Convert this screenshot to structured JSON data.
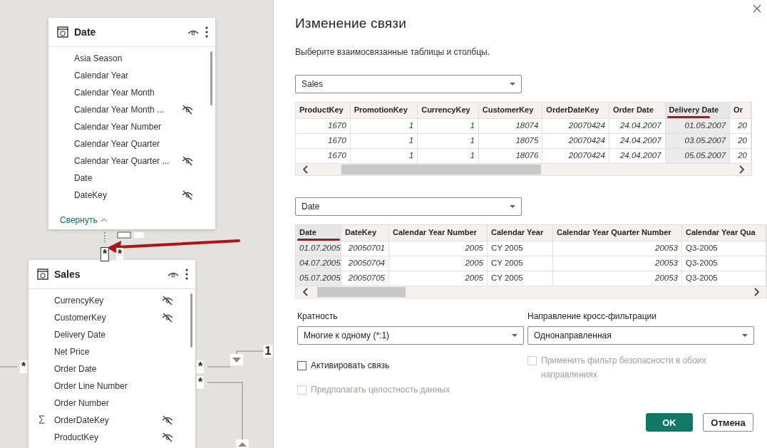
{
  "diagram": {
    "tables": [
      {
        "name": "Date",
        "collapse_link": "Свернуть",
        "fields": [
          {
            "name": "Asia Season",
            "hidden": false,
            "summarized": false
          },
          {
            "name": "Calendar Year",
            "hidden": false,
            "summarized": false
          },
          {
            "name": "Calendar Year Month",
            "hidden": false,
            "summarized": false
          },
          {
            "name": "Calendar Year Month ...",
            "hidden": true,
            "summarized": false
          },
          {
            "name": "Calendar Year Number",
            "hidden": false,
            "summarized": false
          },
          {
            "name": "Calendar Year Quarter",
            "hidden": false,
            "summarized": false
          },
          {
            "name": "Calendar Year Quarter ...",
            "hidden": true,
            "summarized": false
          },
          {
            "name": "Date",
            "hidden": false,
            "summarized": false
          },
          {
            "name": "DateKey",
            "hidden": true,
            "summarized": false
          }
        ]
      },
      {
        "name": "Sales",
        "fields": [
          {
            "name": "CurrencyKey",
            "hidden": true,
            "summarized": false
          },
          {
            "name": "CustomerKey",
            "hidden": true,
            "summarized": false
          },
          {
            "name": "Delivery Date",
            "hidden": false,
            "summarized": false
          },
          {
            "name": "Net Price",
            "hidden": false,
            "summarized": false
          },
          {
            "name": "Order Date",
            "hidden": false,
            "summarized": false
          },
          {
            "name": "Order Line Number",
            "hidden": false,
            "summarized": false
          },
          {
            "name": "Order Number",
            "hidden": false,
            "summarized": false
          },
          {
            "name": "OrderDateKey",
            "hidden": true,
            "summarized": true
          },
          {
            "name": "ProductKey",
            "hidden": true,
            "summarized": false
          }
        ]
      }
    ],
    "markers": [
      {
        "label": "*"
      },
      {
        "label": "*"
      },
      {
        "label": "*"
      },
      {
        "label": "*"
      },
      {
        "label": "*"
      },
      {
        "label": "1"
      }
    ]
  },
  "dialog": {
    "title": "Изменение связи",
    "subtitle": "Выберите взаимосвязанные таблицы и столбцы.",
    "tables": [
      {
        "select": "Sales",
        "columns": [
          {
            "label": "ProductKey",
            "highlighted": false,
            "underlined": false
          },
          {
            "label": "PromotionKey",
            "highlighted": false,
            "underlined": false
          },
          {
            "label": "CurrencyKey",
            "highlighted": false,
            "underlined": false
          },
          {
            "label": "CustomerKey",
            "highlighted": false,
            "underlined": false
          },
          {
            "label": "OrderDateKey",
            "highlighted": false,
            "underlined": false
          },
          {
            "label": "Order Date",
            "highlighted": false,
            "underlined": false
          },
          {
            "label": "Delivery Date",
            "highlighted": true,
            "underlined": true
          },
          {
            "label": "Or",
            "highlighted": false,
            "underlined": false
          }
        ],
        "rows": [
          {
            "cells": [
              "1670",
              "1",
              "1",
              "18074",
              "20070424",
              "24.04.2007",
              "01.05.2007",
              "20"
            ]
          },
          {
            "cells": [
              "1670",
              "1",
              "1",
              "18075",
              "20070424",
              "24.04.2007",
              "03.05.2007",
              "20"
            ]
          },
          {
            "cells": [
              "1670",
              "1",
              "1",
              "18076",
              "20070424",
              "24.04.2007",
              "05.05.2007",
              "20"
            ]
          }
        ]
      },
      {
        "select": "Date",
        "columns": [
          {
            "label": "Date",
            "highlighted": true,
            "underlined": true
          },
          {
            "label": "DateKey",
            "highlighted": false,
            "underlined": false
          },
          {
            "label": "Calendar Year Number",
            "highlighted": false,
            "underlined": false
          },
          {
            "label": "Calendar Year",
            "highlighted": false,
            "underlined": false,
            "kind": "text"
          },
          {
            "label": "Calendar Year Quarter Number",
            "highlighted": false,
            "underlined": false
          },
          {
            "label": "Calendar Year Qua",
            "highlighted": false,
            "underlined": false,
            "kind": "text"
          }
        ],
        "rows": [
          {
            "cells": [
              "01.07.2005",
              "20050701",
              "2005",
              "CY 2005",
              "20053",
              "Q3-2005"
            ]
          },
          {
            "cells": [
              "04.07.2005",
              "20050704",
              "2005",
              "CY 2005",
              "20053",
              "Q3-2005"
            ]
          },
          {
            "cells": [
              "05.07.2005",
              "20050705",
              "2005",
              "CY 2005",
              "20053",
              "Q3-2005"
            ]
          }
        ]
      }
    ],
    "cardinality": {
      "label": "Кратность",
      "value": "Многие к одному (*:1)"
    },
    "cross_filter": {
      "label": "Направление кросс-фильтрации",
      "value": "Однонаправленная"
    },
    "checkboxes": [
      {
        "label": "Активировать связь",
        "checked": false,
        "disabled": false
      },
      {
        "label": "Предполагать целостность данных",
        "checked": false,
        "disabled": true
      },
      {
        "label": "Применить фильтр безопасности в обоих направлениях",
        "checked": false,
        "disabled": true
      }
    ],
    "buttons": [
      {
        "label": "OK",
        "kind": "primary"
      },
      {
        "label": "Отмена",
        "kind": "secondary"
      }
    ]
  }
}
